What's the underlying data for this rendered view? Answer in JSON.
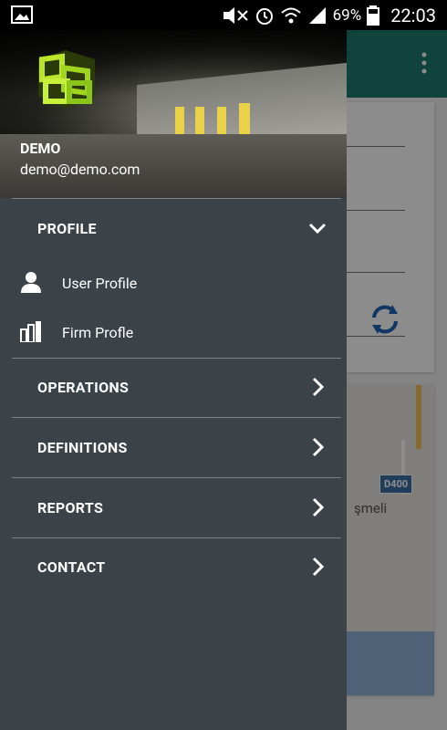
{
  "status_bar": {
    "battery": "69%",
    "time": "22:03"
  },
  "drawer": {
    "user": {
      "name": "DEMO",
      "email": "demo@demo.com"
    },
    "profile_section": {
      "label": "PROFILE",
      "expanded": true,
      "items": [
        {
          "label": "User Profile",
          "icon": "person-icon"
        },
        {
          "label": "Firm Profle",
          "icon": "building-icon"
        }
      ]
    },
    "sections": [
      {
        "label": "OPERATIONS"
      },
      {
        "label": "DEFINITIONS"
      },
      {
        "label": "REPORTS"
      },
      {
        "label": "CONTACT"
      }
    ]
  },
  "background": {
    "map_badge": "D400",
    "map_place_text": "şmeli"
  },
  "colors": {
    "drawer_bg": "#3b4248",
    "app_bar": "#1f7a6f",
    "accent_blue": "#1e63b5"
  }
}
